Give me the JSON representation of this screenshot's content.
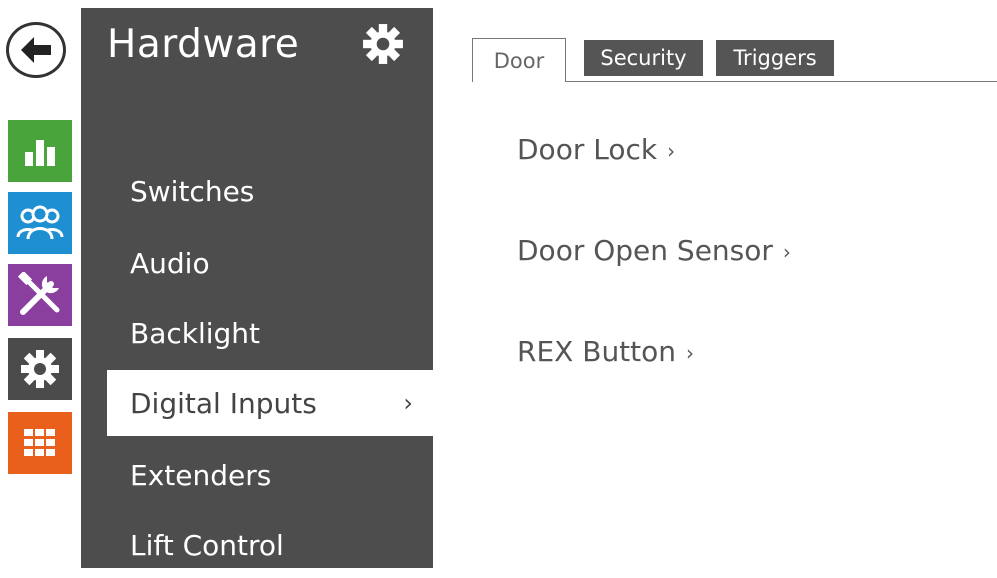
{
  "rail": {
    "back_label": "Back",
    "tiles": [
      {
        "name": "status",
        "icon": "bar-chart-icon",
        "color": "#4aa43c"
      },
      {
        "name": "directory",
        "icon": "users-icon",
        "color": "#1e8fd0"
      },
      {
        "name": "services",
        "icon": "tools-icon",
        "color": "#8a3f9e"
      },
      {
        "name": "hardware",
        "icon": "gear-icon",
        "color": "#4b4b4b"
      },
      {
        "name": "system",
        "icon": "grid-icon",
        "color": "#e8601c"
      }
    ]
  },
  "sidebar": {
    "title": "Hardware",
    "items": [
      {
        "label": "Switches"
      },
      {
        "label": "Audio"
      },
      {
        "label": "Backlight"
      },
      {
        "label": "Digital Inputs",
        "active": true,
        "chevron": "›"
      },
      {
        "label": "Extenders"
      },
      {
        "label": "Lift Control"
      }
    ]
  },
  "tabs": [
    {
      "label": "Door",
      "active": true
    },
    {
      "label": "Security"
    },
    {
      "label": "Triggers"
    }
  ],
  "content": {
    "links": [
      {
        "label": "Door Lock",
        "chevron": "›"
      },
      {
        "label": "Door Open Sensor",
        "chevron": "›"
      },
      {
        "label": "REX Button",
        "chevron": "›"
      }
    ]
  }
}
